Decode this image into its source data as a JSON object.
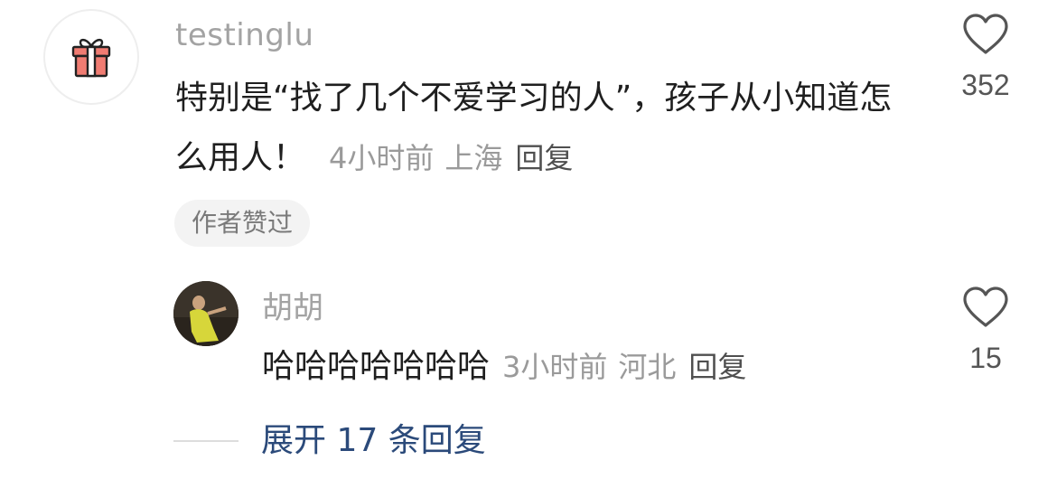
{
  "comment": {
    "avatar_icon": "gift-icon",
    "username": "testinglu",
    "text": "特别是“找了几个不爱学习的人”，孩子从小知道怎么用人！",
    "time": "4小时前",
    "location": "上海",
    "reply_label": "回复",
    "author_liked_badge": "作者赞过",
    "like_icon": "heart-outline-icon",
    "like_count": "352"
  },
  "reply": {
    "username": "胡胡",
    "text": "哈哈哈哈哈哈哈",
    "time": "3小时前",
    "location": "河北",
    "reply_label": "回复",
    "like_icon": "heart-outline-icon",
    "like_count": "15"
  },
  "expand_replies": {
    "label": "展开 17 条回复"
  },
  "colors": {
    "gift_red": "#f07c72",
    "link_blue": "#2b4a7a"
  }
}
